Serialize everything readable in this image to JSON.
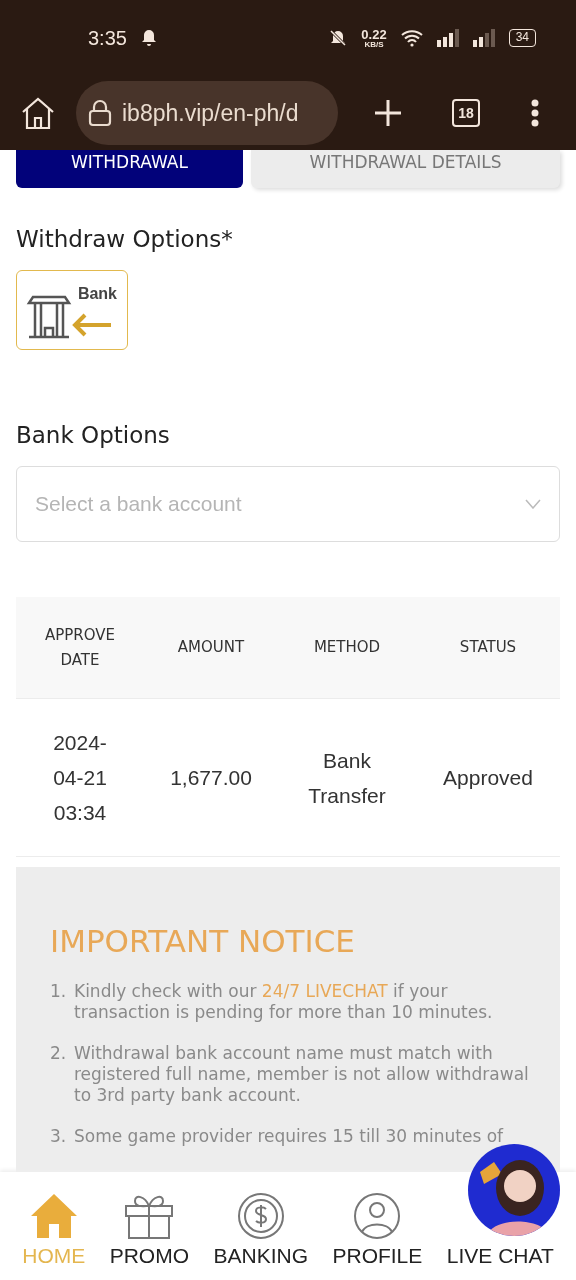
{
  "status_bar": {
    "time": "3:35",
    "speed": "0.22",
    "speed_unit": "KB/S",
    "battery": "34"
  },
  "browser": {
    "url": "ib8ph.vip/en-ph/d",
    "tab_count": "18"
  },
  "tabs": [
    {
      "label": "WITHDRAWAL",
      "selected": true
    },
    {
      "label": "WITHDRAWAL DETAILS",
      "selected": false
    }
  ],
  "withdraw_options": {
    "title": "Withdraw Options*",
    "options": [
      {
        "label": "Bank",
        "selected": true
      }
    ]
  },
  "bank_options": {
    "title": "Bank Options",
    "placeholder": "Select a bank account"
  },
  "table": {
    "columns": [
      "APPROVE DATE",
      "AMOUNT",
      "METHOD",
      "STATUS"
    ],
    "rows": [
      [
        "2024-04-21 03:34",
        "1,677.00",
        "Bank Transfer",
        "Approved"
      ]
    ]
  },
  "notice": {
    "title": "IMPORTANT NOTICE",
    "items": [
      {
        "number": "1.",
        "before": "Kindly check with our ",
        "link": "24/7 LIVECHAT",
        "after": " if your transaction is pending for more than 10 minutes."
      },
      {
        "number": "2.",
        "before": "Withdrawal bank account name must match with registered full name, member is not allow withdrawal to 3rd party bank account."
      },
      {
        "number": "3.",
        "before": "Some game provider requires 15 till 30 minutes of"
      }
    ]
  },
  "bottom_nav": [
    {
      "label": "HOME",
      "selected": true,
      "kind": "home"
    },
    {
      "label": "PROMO",
      "selected": false,
      "kind": "gift"
    },
    {
      "label": "BANKING",
      "selected": false,
      "kind": "coin"
    },
    {
      "label": "PROFILE",
      "selected": false,
      "kind": "user"
    },
    {
      "label": "LIVE CHAT",
      "selected": false,
      "kind": "chat"
    }
  ]
}
